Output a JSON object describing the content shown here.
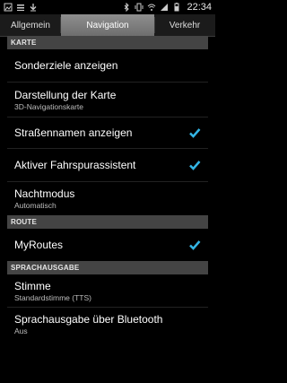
{
  "status_bar": {
    "time": "22:34",
    "icons_left": [
      "image-icon",
      "menu-icon",
      "download-icon"
    ],
    "icons_right": [
      "bluetooth-icon",
      "vibrate-icon",
      "wifi-icon",
      "signal-icon",
      "battery-icon"
    ]
  },
  "tabs": [
    "Allgemein",
    "Navigation",
    "Verkehr"
  ],
  "sections": {
    "karte": "KARTE",
    "route": "ROUTE",
    "sprachausgabe": "SPRACHAUSGABE"
  },
  "items": {
    "sonderziele": {
      "title": "Sonderziele anzeigen"
    },
    "darstellung": {
      "title": "Darstellung der Karte",
      "subtitle": "3D-Navigationskarte"
    },
    "strassennamen": {
      "title": "Straßennamen anzeigen",
      "checked": true
    },
    "fahrspur": {
      "title": "Aktiver Fahrspurassistent",
      "checked": true
    },
    "nachtmodus": {
      "title": "Nachtmodus",
      "subtitle": "Automatisch"
    },
    "myroutes": {
      "title": "MyRoutes",
      "checked": true
    },
    "stimme": {
      "title": "Stimme",
      "subtitle": "Standardstimme (TTS)"
    },
    "bluetooth": {
      "title": "Sprachausgabe über Bluetooth",
      "subtitle": "Aus"
    }
  },
  "colors": {
    "accent": "#33b5e5",
    "background": "#000000",
    "section": "#444444"
  }
}
